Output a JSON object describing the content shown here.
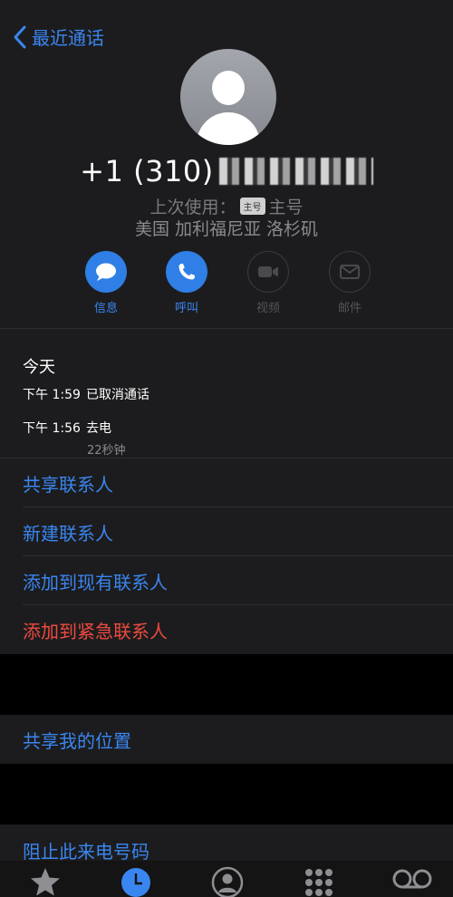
{
  "nav": {
    "back_label": "最近通话"
  },
  "contact": {
    "number_visible": "+1 (310)",
    "last_used_label": "上次使用：",
    "sim_tag": "主号",
    "sim_name": "主号",
    "location": "美国 加利福尼亚 洛杉矶"
  },
  "actions": [
    {
      "label": "信息",
      "icon": "message-icon",
      "enabled": true
    },
    {
      "label": "呼叫",
      "icon": "phone-icon",
      "enabled": true
    },
    {
      "label": "视频",
      "icon": "video-icon",
      "enabled": false
    },
    {
      "label": "邮件",
      "icon": "mail-icon",
      "enabled": false
    }
  ],
  "history": {
    "heading": "今天",
    "calls": [
      {
        "time": "下午 1:59",
        "status": "已取消通话",
        "duration": ""
      },
      {
        "time": "下午 1:56",
        "status": "去电",
        "duration": "22秒钟"
      }
    ]
  },
  "options": {
    "share_contact": "共享联系人",
    "new_contact": "新建联系人",
    "add_existing": "添加到现有联系人",
    "add_emergency": "添加到紧急联系人",
    "share_location": "共享我的位置",
    "block_caller": "阻止此来电号码"
  },
  "tabbar": {
    "items": [
      "star-icon",
      "clock-icon",
      "person-icon",
      "keypad-icon",
      "voicemail-icon"
    ],
    "active_index": 1
  },
  "colors": {
    "accent": "#3a86f0",
    "destructive": "#ee4a3e",
    "background": "#1c1c1e"
  }
}
